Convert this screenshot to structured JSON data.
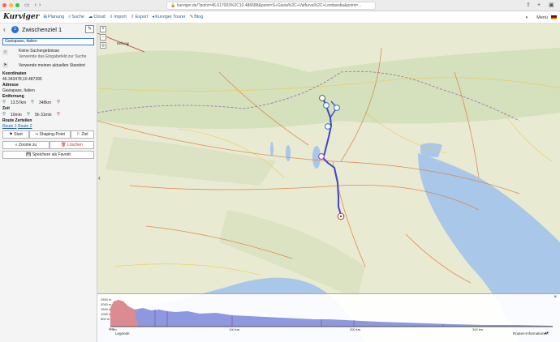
{
  "browser": {
    "url": "kurviger.de/?point=46.617003%2C10.486688&point=S+Gavia%2C+Valfurva%2C+Lombardia&point=...",
    "back_icon": "chevron-left-icon",
    "forward_icon": "chevron-right-icon"
  },
  "nav": {
    "logo": "Kurviger",
    "items": [
      {
        "label": "Planung",
        "icon": "map-icon"
      },
      {
        "label": "Suche",
        "icon": "search-icon"
      },
      {
        "label": "Cloud",
        "icon": "cloud-icon"
      },
      {
        "label": "Import",
        "icon": "import-icon"
      },
      {
        "label": "Export",
        "icon": "export-icon"
      },
      {
        "label": "Kurviger Tourer",
        "icon": "tourer-icon"
      },
      {
        "label": "Blog",
        "icon": "blog-icon"
      }
    ],
    "menu_label": "Menü"
  },
  "sidebar": {
    "badge_number": "1",
    "title": "Zwischenziel 1",
    "search_value": "Gaviapass, Italien",
    "no_results_title": "Keine Suchergebnisse",
    "no_results_hint": "Verwende das Eingabefeld zur Suche",
    "use_location": "Verwende meinen aktuellen Standort",
    "coords_label": "Koordinaten",
    "coords_value": "46.343478,10.487395",
    "address_label": "Adresse",
    "address_value": "Gaviapass, Italien",
    "distance_label": "Entfernung",
    "distance_from": "13.57km",
    "distance_to": "348km",
    "time_label": "Zeit",
    "time_from": "10min",
    "time_to": "5h 31min",
    "route_label": "Route Zerteilen",
    "route1": "Route 1",
    "route2": "Route 2",
    "start_btn": "Start",
    "shaping_btn": "Shaping-Point",
    "ziel_btn": "Ziel",
    "zoom_btn": "Zoome zu",
    "delete_btn": "Löschen",
    "favorite_btn": "Speichere als Favorit"
  },
  "map": {
    "zoom_in": "+",
    "zoom_out": "−",
    "city_label": "Belluno"
  },
  "profile": {
    "y_ticks": [
      "2500 m",
      "2000 m",
      "1500 m",
      "1000 m",
      "500 m",
      "0 m"
    ],
    "x_ticks": [
      "0 km",
      "100 km",
      "200 km",
      "300 km"
    ],
    "legend": "Legende",
    "route_info": "Routen-Informationen",
    "close": "×"
  },
  "colors": {
    "accent": "#2f6fd1",
    "route": "#3f46c9",
    "sea": "#a9c7e8",
    "land": "#e8ead2"
  }
}
